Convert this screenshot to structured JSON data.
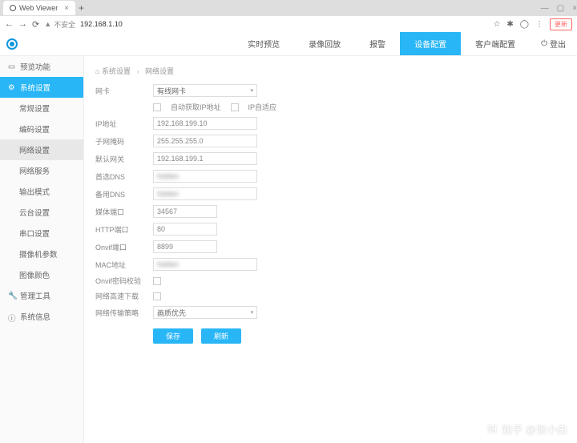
{
  "browser": {
    "tab_title": "Web Viewer",
    "insecure_label": "不安全",
    "url": "192.168.1.10",
    "update_label": "更新"
  },
  "topnav": {
    "items": [
      "实时预览",
      "录像回放",
      "报警",
      "设备配置",
      "客户端配置"
    ],
    "active": 3,
    "logout": "登出"
  },
  "sidebar": {
    "groups": [
      {
        "label": "预览功能",
        "icon": "monitor-icon"
      },
      {
        "label": "系统设置",
        "icon": "gear-icon",
        "active": true,
        "children": [
          {
            "label": "常规设置"
          },
          {
            "label": "编码设置"
          },
          {
            "label": "网络设置",
            "sel": true
          },
          {
            "label": "网络服务"
          },
          {
            "label": "输出模式"
          },
          {
            "label": "云台设置"
          },
          {
            "label": "串口设置"
          },
          {
            "label": "摄像机参数"
          },
          {
            "label": "图像颜色"
          }
        ]
      },
      {
        "label": "管理工具",
        "icon": "wrench-icon"
      },
      {
        "label": "系统信息",
        "icon": "info-icon"
      }
    ]
  },
  "breadcrumb": [
    "系统设置",
    "网络设置"
  ],
  "form": {
    "nic_label": "网卡",
    "nic_value": "有线网卡",
    "auto_ip_label": "自动获取IP地址",
    "ip_adaptive_label": "IP自适应",
    "ip_label": "IP地址",
    "ip_value": "192.168.199.10",
    "mask_label": "子网掩码",
    "mask_value": "255.255.255.0",
    "gw_label": "默认网关",
    "gw_value": "192.168.199.1",
    "dns1_label": "首选DNS",
    "dns1_value": "hidden",
    "dns2_label": "备用DNS",
    "dns2_value": "hidden",
    "media_port_label": "媒体端口",
    "media_port_value": "34567",
    "http_port_label": "HTTP端口",
    "http_port_value": "80",
    "onvif_port_label": "Onvif端口",
    "onvif_port_value": "8899",
    "mac_label": "MAC地址",
    "mac_value": "hidden",
    "onvif_chk_label": "Onvif密码校验",
    "hs_dl_label": "网络高速下载",
    "strategy_label": "网络传输策略",
    "strategy_value": "画质优先",
    "save_btn": "保存",
    "refresh_btn": "刷新"
  },
  "watermark": "知乎 @张小白"
}
